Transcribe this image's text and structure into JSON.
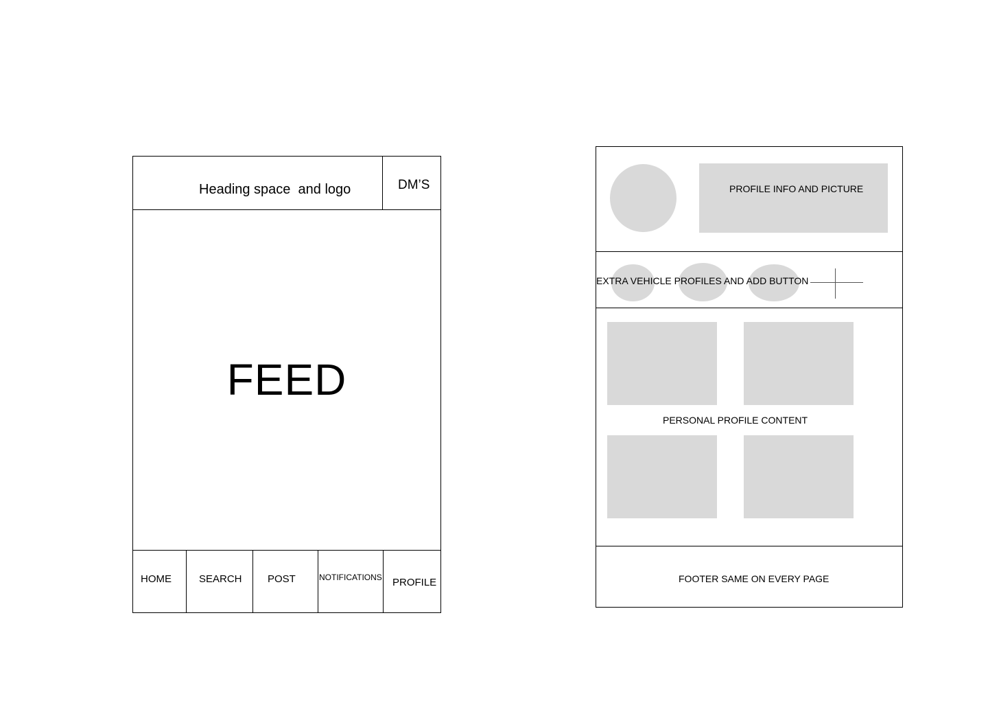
{
  "feed_screen": {
    "header_title": "Heading space  and logo",
    "dms_label": "DM’S",
    "feed_label": "FEED",
    "nav": {
      "home": "HOME",
      "search": "SEARCH",
      "post": "POST",
      "notifications": "NOTIFICATIONS",
      "profile": "PROFILE"
    }
  },
  "profile_screen": {
    "profile_info_label": "PROFILE INFO AND PICTURE",
    "vehicle_label": "EXTRA VEHICLE PROFILES AND ADD BUTTON",
    "content_label": "PERSONAL PROFILE CONTENT",
    "footer_label": "FOOTER SAME ON EVERY PAGE"
  },
  "colors": {
    "placeholder_fill": "#d9d9d9",
    "border": "#000000",
    "background": "#ffffff"
  },
  "icons": {
    "add_vehicle": "plus-icon"
  }
}
